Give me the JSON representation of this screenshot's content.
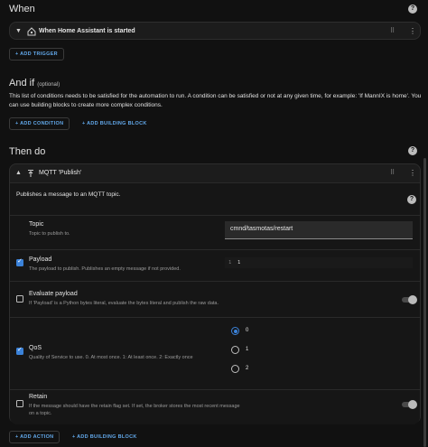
{
  "when": {
    "title": "When",
    "trigger_label": "When Home Assistant is started",
    "add_trigger": "+ ADD TRIGGER"
  },
  "andif": {
    "title": "And if",
    "title_suffix": "(optional)",
    "description": "This list of conditions needs to be satisfied for the automation to run. A condition can be satisfied or not at any given time, for example: 'If MannIX is home'. You can use building blocks to create more complex conditions.",
    "add_condition": "+ ADD CONDITION",
    "add_building_block": "+ ADD BUILDING BLOCK"
  },
  "thendo": {
    "title": "Then do",
    "action_label": "MQTT 'Publish'",
    "action_description": "Publishes a message to an MQTT topic.",
    "topic": {
      "label": "Topic",
      "hint": "Topic to publish to.",
      "value": "cmnd/tasmotas/restart"
    },
    "payload": {
      "label": "Payload",
      "hint": "The payload to publish. Publishes an empty message if not provided.",
      "line_number": "1",
      "value": "1",
      "checked": true
    },
    "evaluate": {
      "label": "Evaluate payload",
      "hint": "If 'Payload' is a Python bytes literal, evaluate the bytes literal and publish the raw data.",
      "checked": false,
      "enabled": false
    },
    "qos": {
      "label": "QoS",
      "hint": "Quality of Service to use. 0. At most once. 1: At least once. 2: Exactly once",
      "checked": true,
      "options": [
        "0",
        "1",
        "2"
      ],
      "selected": "0"
    },
    "retain": {
      "label": "Retain",
      "hint": "If the message should have the retain flag set. If set, the broker stores the most recent message on a topic.",
      "checked": false,
      "enabled": false
    },
    "add_action": "+ ADD ACTION",
    "add_building_block": "+ ADD BUILDING BLOCK"
  },
  "colors": {
    "accent": "#62a8ea",
    "checkbox": "#3b82d9",
    "background": "#111111",
    "card": "#1c1c1c"
  },
  "icons": [
    "help-icon",
    "chevron-down-icon",
    "home-assistant-icon",
    "drag-handle-icon",
    "more-vert-icon",
    "chevron-up-icon",
    "mqtt-publish-icon"
  ]
}
